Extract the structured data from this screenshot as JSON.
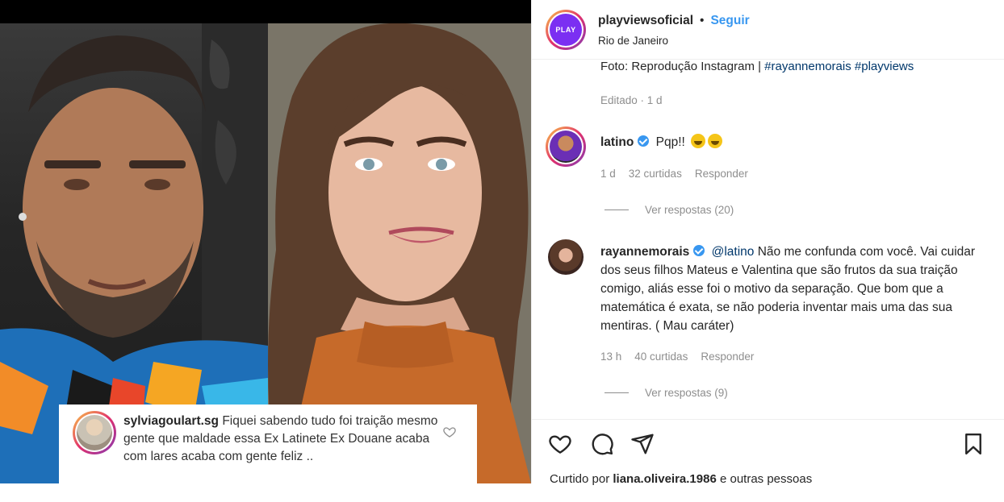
{
  "post": {
    "overlay_comment": {
      "username": "sylviagoulart.sg",
      "text": "Fiquei sabendo tudo foi traição mesmo gente que maldade essa Ex Latinete Ex Douane acaba com lares acaba com gente feliz .."
    }
  },
  "header": {
    "avatar_text": "PLAY",
    "username": "playviewsoficial",
    "separator": "•",
    "follow_label": "Seguir",
    "location": "Rio de Janeiro"
  },
  "caption": {
    "prefix": "Foto: Reprodução Instagram | ",
    "hashtags": "#rayannemorais #playviews",
    "edited": "Editado · 1 d"
  },
  "comments": [
    {
      "username": "latino",
      "text": "Pqp!!",
      "time": "1 d",
      "likes": "32 curtidas",
      "reply_label": "Responder",
      "view_replies": "Ver respostas (20)"
    },
    {
      "username": "rayannemorais",
      "mention": "@latino",
      "text": " Não me confunda com você. Vai cuidar dos seus filhos Mateus e Valentina que são frutos da sua traição comigo, aliás esse foi o motivo da separação. Que bom que a matemática é exata, se não poderia inventar mais uma das sua mentiras. ( Mau caráter)",
      "time": "13 h",
      "likes": "40 curtidas",
      "reply_label": "Responder",
      "view_replies": "Ver respostas (9)"
    }
  ],
  "footer": {
    "liked_prefix": "Curtido por ",
    "liked_user": "liana.oliveira.1986",
    "liked_suffix": " e outras pessoas"
  },
  "colors": {
    "link_blue": "#3897f0",
    "hashtag_blue": "#00376b",
    "muted": "#8e8e8e",
    "brand_purple": "#7b2ff2"
  },
  "icons": [
    "heart-icon",
    "comment-icon",
    "share-icon",
    "bookmark-icon",
    "verified-icon"
  ]
}
